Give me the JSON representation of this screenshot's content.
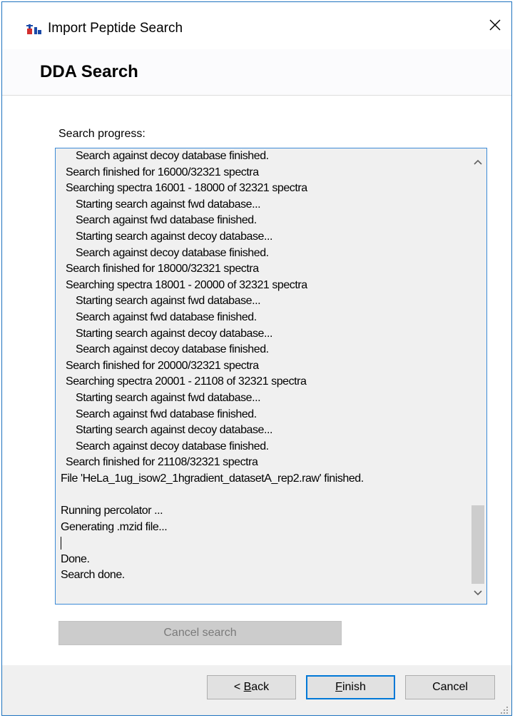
{
  "window": {
    "title": "Import Peptide Search"
  },
  "header": {
    "title": "DDA Search"
  },
  "progress": {
    "label": "Search progress:"
  },
  "log": {
    "lines": [
      {
        "text": "Search against decoy database finished.",
        "indent": 2
      },
      {
        "text": "Search finished for 16000/32321 spectra",
        "indent": 1
      },
      {
        "text": "Searching spectra 16001 - 18000 of 32321 spectra",
        "indent": 1
      },
      {
        "text": "Starting search against fwd database...",
        "indent": 2
      },
      {
        "text": "Search against fwd database finished.",
        "indent": 2
      },
      {
        "text": "Starting search against decoy database...",
        "indent": 2
      },
      {
        "text": "Search against decoy database finished.",
        "indent": 2
      },
      {
        "text": "Search finished for 18000/32321 spectra",
        "indent": 1
      },
      {
        "text": "Searching spectra 18001 - 20000 of 32321 spectra",
        "indent": 1
      },
      {
        "text": "Starting search against fwd database...",
        "indent": 2
      },
      {
        "text": "Search against fwd database finished.",
        "indent": 2
      },
      {
        "text": "Starting search against decoy database...",
        "indent": 2
      },
      {
        "text": "Search against decoy database finished.",
        "indent": 2
      },
      {
        "text": "Search finished for 20000/32321 spectra",
        "indent": 1
      },
      {
        "text": "Searching spectra 20001 - 21108 of 32321 spectra",
        "indent": 1
      },
      {
        "text": "Starting search against fwd database...",
        "indent": 2
      },
      {
        "text": "Search against fwd database finished.",
        "indent": 2
      },
      {
        "text": "Starting search against decoy database...",
        "indent": 2
      },
      {
        "text": "Search against decoy database finished.",
        "indent": 2
      },
      {
        "text": "Search finished for 21108/32321 spectra",
        "indent": 1
      },
      {
        "text": "File 'HeLa_1ug_isow2_1hgradient_datasetA_rep2.raw' finished.",
        "indent": 0
      },
      {
        "text": "",
        "indent": 0
      },
      {
        "text": "Running percolator ...",
        "indent": 0
      },
      {
        "text": "Generating .mzid file...",
        "indent": 0
      },
      {
        "text": "",
        "indent": 0,
        "caret": true
      },
      {
        "text": "Done.",
        "indent": 0
      },
      {
        "text": "Search done.",
        "indent": 0
      }
    ]
  },
  "buttons": {
    "cancel_search": "Cancel search",
    "back_prefix": "< ",
    "back_mnemonic": "B",
    "back_rest": "ack",
    "finish_mnemonic": "F",
    "finish_rest": "inish",
    "cancel": "Cancel"
  },
  "icons": {
    "app": "peptide-app-icon",
    "close": "close-icon",
    "scroll_up": "chevron-up-icon",
    "scroll_down": "chevron-down-icon",
    "grip": "resize-grip-icon"
  },
  "colors": {
    "window_border": "#1e73be",
    "log_border": "#3c8ad6",
    "default_button_border": "#0078d7"
  }
}
